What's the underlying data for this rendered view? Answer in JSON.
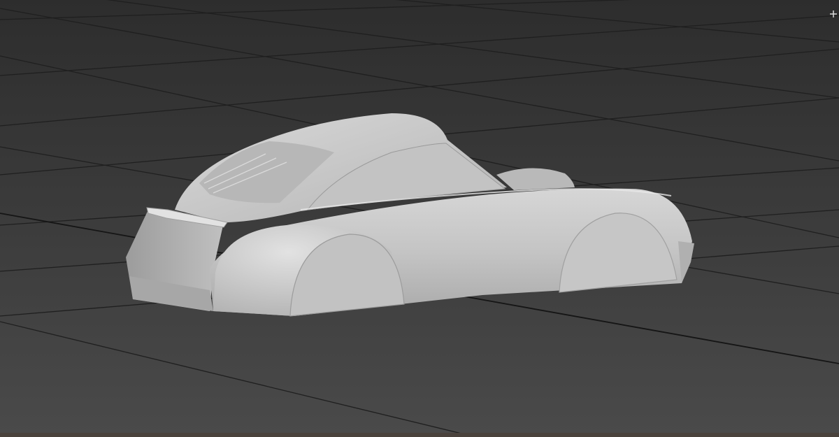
{
  "viewport": {
    "background_top": "#2e2e2e",
    "background_bottom": "#474747",
    "grid_color": "#1e1e1e",
    "grid_axis_color": "#141414",
    "model_color": "#c9c9c9",
    "model_shadow_color": "#8f8f8f",
    "model_highlight_color": "#e6e6e6"
  },
  "model": {
    "icon": "car-body-mesh"
  },
  "overlay": {
    "corner_icon": "plus-marker-icon",
    "bottom_bar_color": "#4a423c"
  }
}
